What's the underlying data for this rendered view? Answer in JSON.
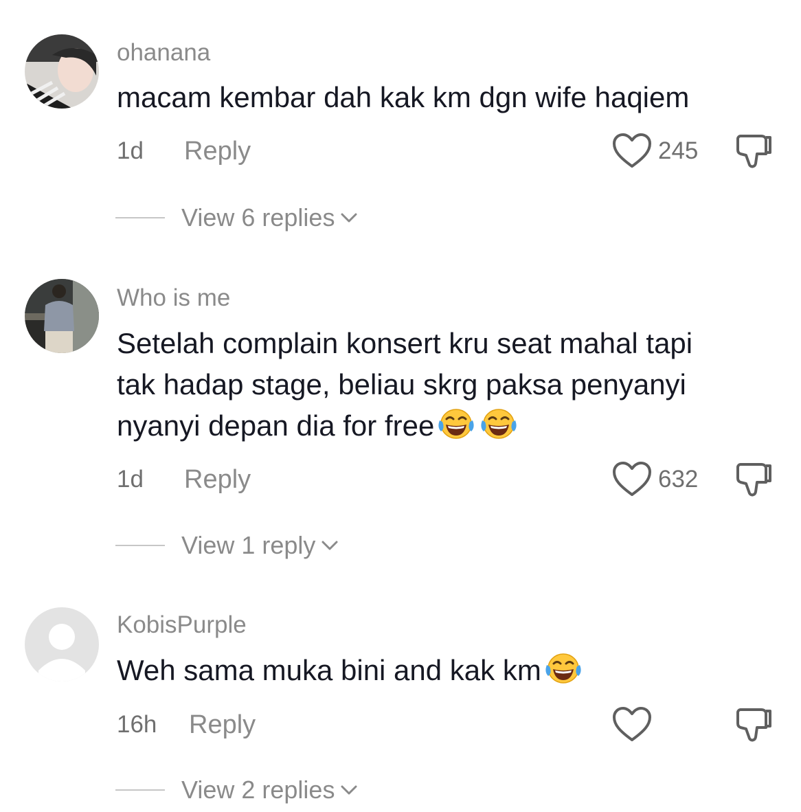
{
  "comments": [
    {
      "username": "ohanana",
      "text": "macam kembar dah kak km dgn wife haqiem",
      "time": "1d",
      "reply_label": "Reply",
      "likes": "245",
      "view_replies": "View 6 replies",
      "emoji": "none"
    },
    {
      "username": "Who is me",
      "text_lines": [
        "Setelah complain konsert kru seat mahal tapi",
        "tak hadap stage, beliau skrg paksa penyanyi",
        "nyanyi depan dia for free"
      ],
      "time": "1d",
      "reply_label": "Reply",
      "likes": "632",
      "view_replies": "View 1 reply",
      "emoji": "face-with-tears-of-joy x2"
    },
    {
      "username": "KobisPurple",
      "text": "Weh sama muka bini and kak km",
      "time": "16h",
      "reply_label": "Reply",
      "likes": "",
      "view_replies": "View 2 replies",
      "emoji": "face-with-tears-of-joy x1"
    }
  ],
  "icons": {
    "like": "heart-outline-icon",
    "dislike": "thumbs-down-outline-icon",
    "expand": "chevron-down-icon",
    "emoji": "face-with-tears-of-joy-icon"
  },
  "colors": {
    "username": "#8a8a8a",
    "body_text": "#161823",
    "meta": "#6f6f6f",
    "icon": "#5f5f5f",
    "divider": "#c6c6c6"
  }
}
